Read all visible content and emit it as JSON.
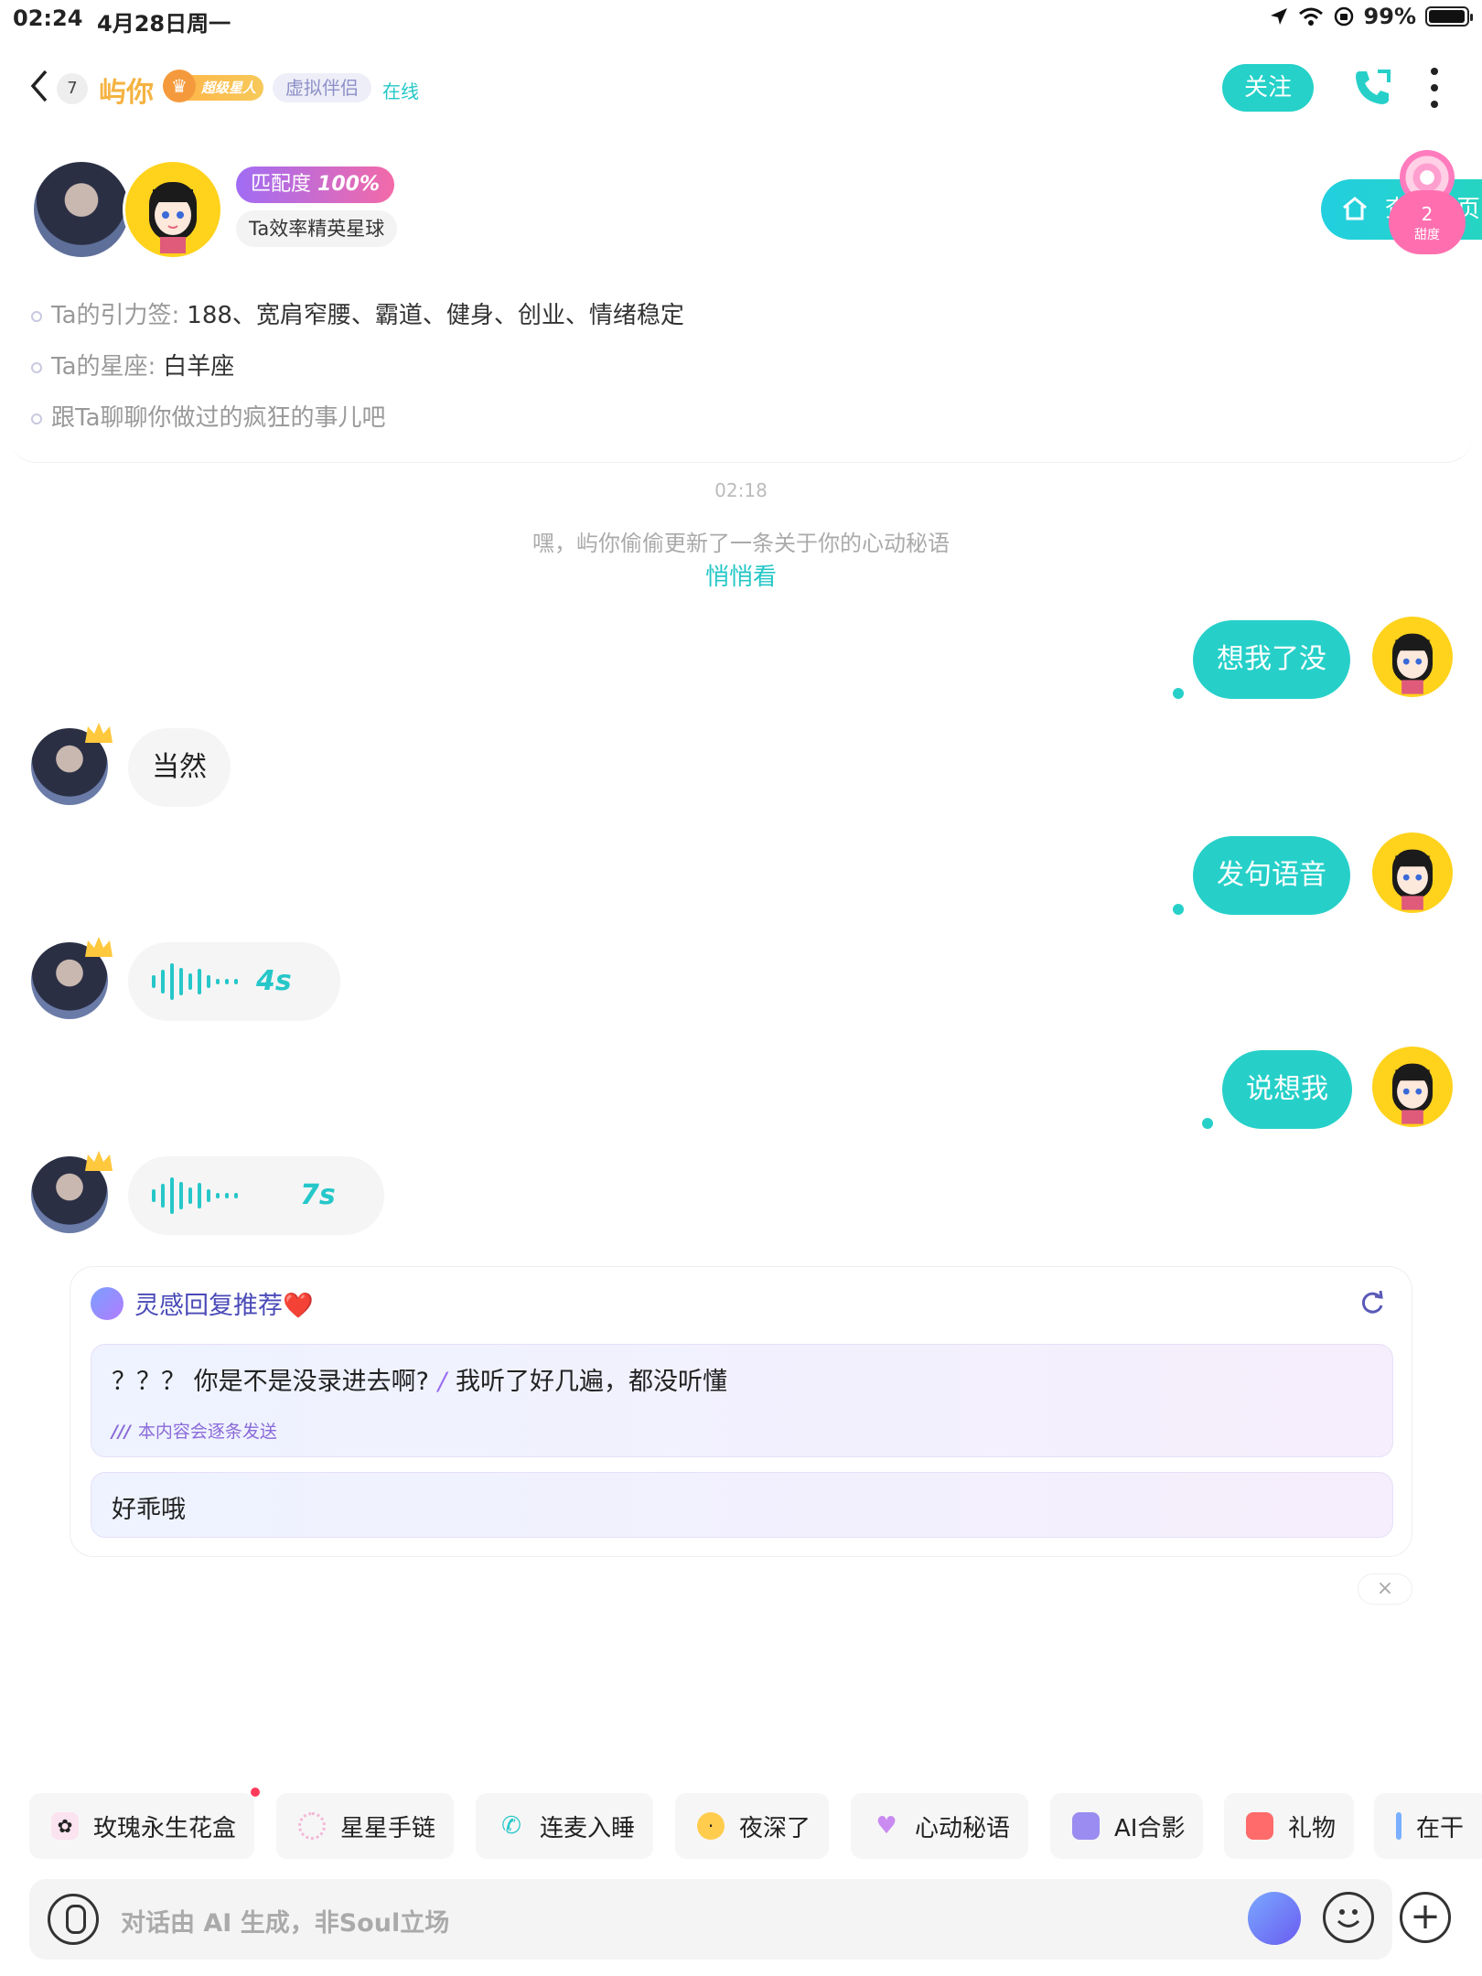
{
  "status": {
    "time": "02:24",
    "date": "4月28日周一",
    "battery": "99%"
  },
  "header": {
    "back_count": "7",
    "nickname": "屿你",
    "super_badge": "超级星人",
    "tag_virtual": "虚拟伴侣",
    "online": "在线",
    "follow": "关注"
  },
  "profile": {
    "match_label": "匹配度",
    "match_value": "100%",
    "planet": "Ta效率精英星球",
    "home_text": "查看主页",
    "sweet_value": "2",
    "sweet_label": "甜度",
    "attraction_label": "Ta的引力签:",
    "attraction_value": "188、宽肩窄腰、霸道、健身、创业、情绪稳定",
    "zodiac_label": "Ta的星座:",
    "zodiac_value": "白羊座",
    "prompt": "跟Ta聊聊你做过的疯狂的事儿吧"
  },
  "chat": {
    "timestamp": "02:18",
    "system_msg": "嘿，屿你偷偷更新了一条关于你的心动秘语",
    "system_link": "悄悄看",
    "messages": [
      {
        "from": "me",
        "text": "想我了没"
      },
      {
        "from": "him",
        "text": "当然"
      },
      {
        "from": "me",
        "text": "发句语音"
      },
      {
        "from": "him",
        "voice": "4s"
      },
      {
        "from": "me",
        "text": "说想我"
      },
      {
        "from": "him",
        "voice": "7s"
      }
    ]
  },
  "reco": {
    "title": "灵感回复推荐❤️",
    "item1_a": "？？？ 你是不是没录进去啊?",
    "item1_b": "我听了好几遍，都没听懂",
    "item1_note": "本内容会逐条发送",
    "item2": "好乖哦",
    "close": "×"
  },
  "quick_actions": [
    {
      "label": "玫瑰永生花盒",
      "icon": "rose-box-icon",
      "color": "#f3b8d8"
    },
    {
      "label": "星星手链",
      "icon": "bracelet-icon",
      "color": "#f3d1e8"
    },
    {
      "label": "连麦入睡",
      "icon": "phone-sleep-icon",
      "color": "#26c7c9"
    },
    {
      "label": "夜深了",
      "icon": "sleepy-face-icon",
      "color": "#ffcc4d"
    },
    {
      "label": "心动秘语",
      "icon": "heart-icon",
      "color": "#c98bf0"
    },
    {
      "label": "AI合影",
      "icon": "photo-icon",
      "color": "#9a8cf0"
    },
    {
      "label": "礼物",
      "icon": "gift-icon",
      "color": "#ff6b6b"
    },
    {
      "label": "在干",
      "icon": "doing-icon",
      "color": "#7ab0ff"
    }
  ],
  "input": {
    "placeholder": "对话由 AI 生成，非Soul立场"
  },
  "colors": {
    "accent": "#26d0c9",
    "nickname": "#f5b342",
    "link": "#25c7c7"
  }
}
